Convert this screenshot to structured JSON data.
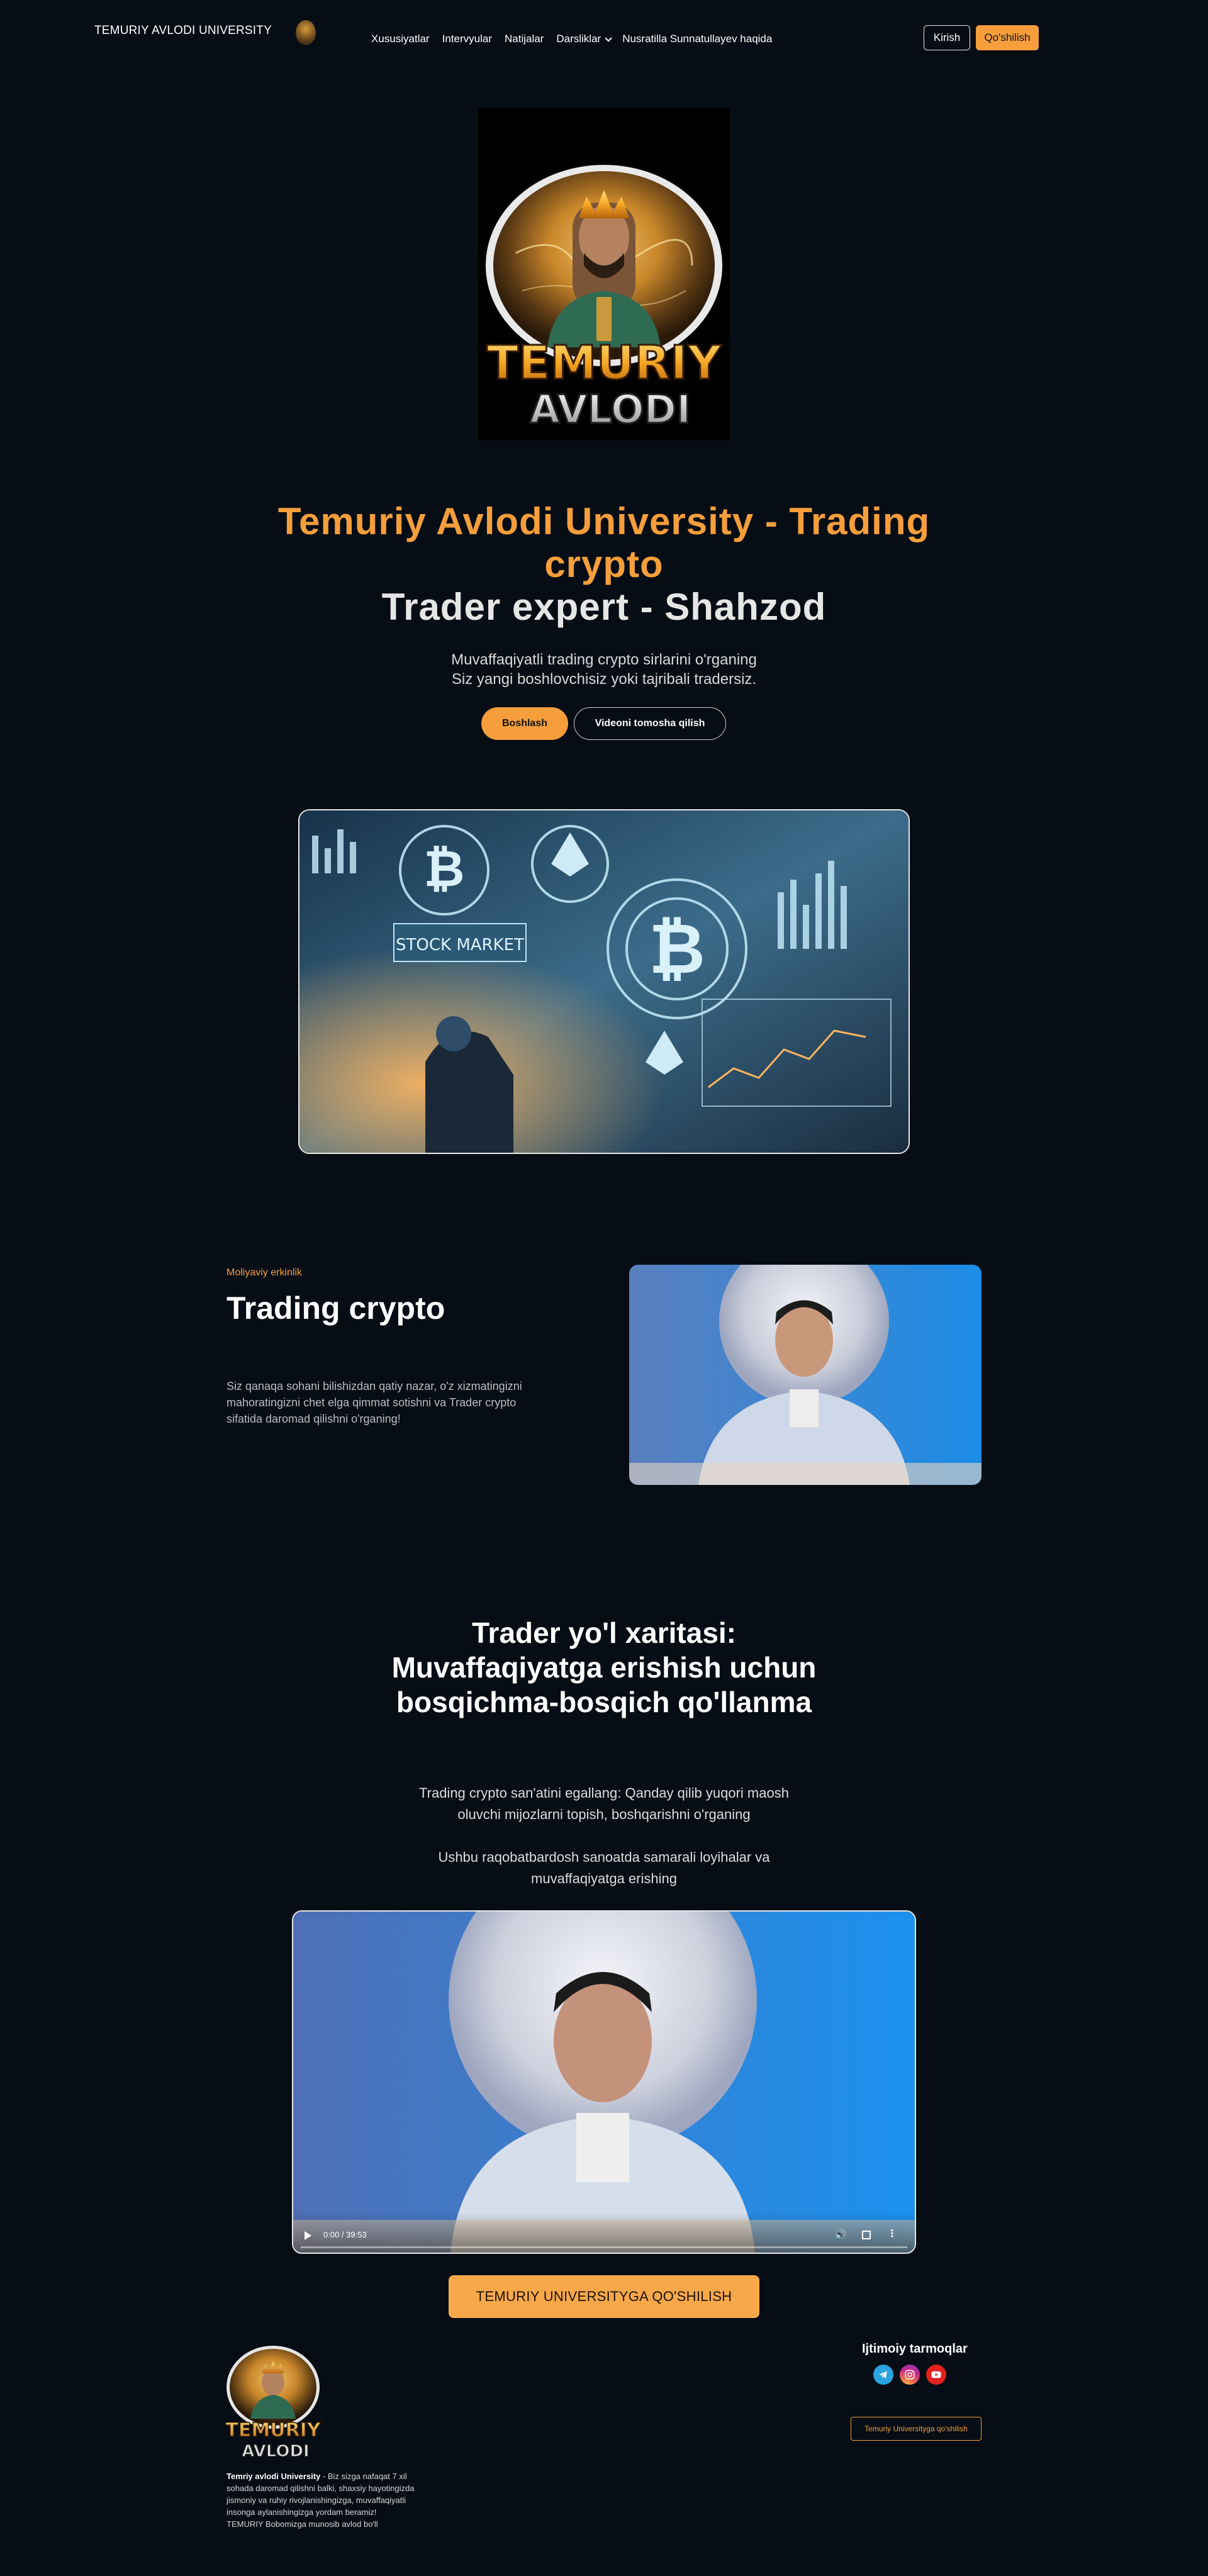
{
  "nav": {
    "brand": "TEMURIY AVLODI UNIVERSITY",
    "links": [
      "Xususiyatlar",
      "Intervyular",
      "Natijalar",
      "Darsliklar",
      "Nusratilla Sunnatullayev haqida"
    ],
    "login_label": "Kirish",
    "join_label": "Qo'shilish"
  },
  "hero": {
    "logo_text_top": "TEMURIY",
    "logo_text_bottom": "AVLODI",
    "title_line1": "Temuriy Avlodi University - Trading",
    "title_line2": "crypto",
    "title_line3": "Trader expert - Shahzod",
    "subtitle_line1": "Muvaffaqiyatli trading crypto sirlarini o'rganing",
    "subtitle_line2": "Siz yangi boshlovchisiz yoki tajribali tradersiz.",
    "start_label": "Boshlash",
    "video_label": "Videoni tomosha qilish",
    "image_caption": "STOCK MARKET"
  },
  "feature": {
    "label": "Moliyaviy erkinlik",
    "title": "Trading crypto",
    "text": "Siz qanaqa sohani bilishizdan qatiy nazar, o'z xizmatingizni mahoratingizni chet elga qimmat sotishni va Trader crypto sifatida daromad qilishni o'rganing!"
  },
  "roadmap": {
    "title_line1": "Trader yo'l xaritasi:",
    "title_line2": "Muvaffaqiyatga erishish uchun",
    "title_line3": "bosqichma-bosqich qo'llanma",
    "text1_line1": "Trading crypto san'atini egallang: Qanday qilib yuqori maosh",
    "text1_line2": "oluvchi mijozlarni topish, boshqarishni o'rganing",
    "text2_line1": "Ushbu raqobatbardosh sanoatda samarali loyihalar va",
    "text2_line2": "muvaffaqiyatga erishing",
    "video_time": "0:00 / 39:53",
    "cta_label": "TEMURIY UNIVERSITYGA QO'SHILISH"
  },
  "footer": {
    "brand_bold": "Temriy avlodi University",
    "description": " - Biz sizga nafaqat 7 xil sohada daromad qilishni balki, shaxsiy hayotingizda jismoniy va ruhiy rivojlanishingizga, muvaffaqiyatli insonga aylanishingizga yordam beramiz! TEMURIY Bobomizga munosib avlod bo'll",
    "social_title": "Ijtimoiy tarmoqlar",
    "join_button": "Temuriy Universityga qo'shilish",
    "socials": [
      "telegram-icon",
      "instagram-icon",
      "youtube-icon"
    ]
  },
  "colors": {
    "accent": "#f59e3b",
    "background": "#070d14"
  }
}
